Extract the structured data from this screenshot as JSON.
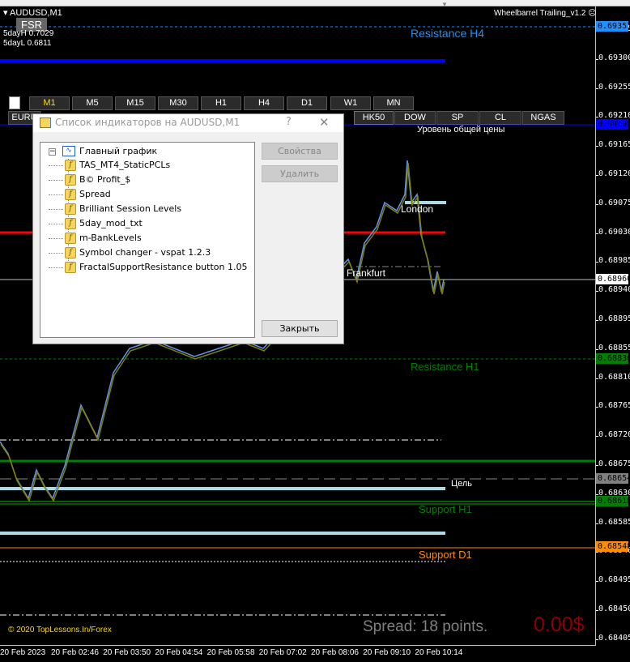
{
  "chart": {
    "symbol": "AUDUSD,M1",
    "ea_name": "Wheelbarrel Trailing_v1.2",
    "fsr_button": "FSR",
    "five_day_high": "5dayH 0.7029",
    "five_day_low": "5dayL 0.6811",
    "copyright": "© 2020 TopLessons.In/Forex",
    "spread": "Spread: 18 points.",
    "profit": "0.00$"
  },
  "timeframes": [
    "M1",
    "M5",
    "M15",
    "M30",
    "H1",
    "H4",
    "D1",
    "W1",
    "MN"
  ],
  "active_timeframe": "M1",
  "symbols": [
    "EURU",
    "HK50",
    "DOW",
    "SP",
    "CL",
    "NGAS"
  ],
  "labels": {
    "resistance_h4": "Resistance H4",
    "common_price_level": "Уровень общей цены",
    "london": "London",
    "frankfurt": "Frankfurt",
    "resistance_h1": "Resistance H1",
    "target": "Цель",
    "support_h1": "Support H1",
    "support_d1": "Support D1"
  },
  "price_axis": [
    "0.69345",
    "0.69300",
    "0.69255",
    "0.69210",
    "0.69165",
    "0.69120",
    "0.69075",
    "0.69030",
    "0.68985",
    "0.68940",
    "0.68895",
    "0.68855",
    "0.68810",
    "0.68765",
    "0.68720",
    "0.68675",
    "0.68630",
    "0.68585",
    "0.68540",
    "0.68495",
    "0.68450",
    "0.68405"
  ],
  "price_badges": [
    {
      "value": "0.69351",
      "bg": "#1e90ff",
      "fg": "#000"
    },
    {
      "value": "0.69198",
      "bg": "#0000ff",
      "fg": "#000"
    },
    {
      "value": "0.68960",
      "bg": "#ffffff",
      "fg": "#000"
    },
    {
      "value": "0.68836",
      "bg": "#008000",
      "fg": "#000"
    },
    {
      "value": "0.68654",
      "bg": "#808080",
      "fg": "#000"
    },
    {
      "value": "0.68618",
      "bg": "#008000",
      "fg": "#000"
    },
    {
      "value": "0.68548",
      "bg": "#ff8c00",
      "fg": "#000"
    }
  ],
  "time_axis": [
    "20 Feb 2023",
    "20 Feb 02:46",
    "20 Feb 03:50",
    "20 Feb 04:54",
    "20 Feb 05:58",
    "20 Feb 07:02",
    "20 Feb 08:06",
    "20 Feb 09:10",
    "20 Feb 10:14"
  ],
  "dialog": {
    "title": "Список индикаторов на AUDUSD,M1",
    "help": "?",
    "close": "✕",
    "root": "Главный график",
    "indicators": [
      "TAS_MT4_StaticPCLs",
      "B© Profit_$",
      "Spread",
      "Brilliant Session Levels",
      "5day_mod_txt",
      "m-BankLevels",
      "Symbol changer - vspat 1.2.3",
      "FractalSupportResistance button 1.05"
    ],
    "properties_button": "Свойства",
    "delete_button": "Удалить",
    "close_button": "Закрыть"
  }
}
